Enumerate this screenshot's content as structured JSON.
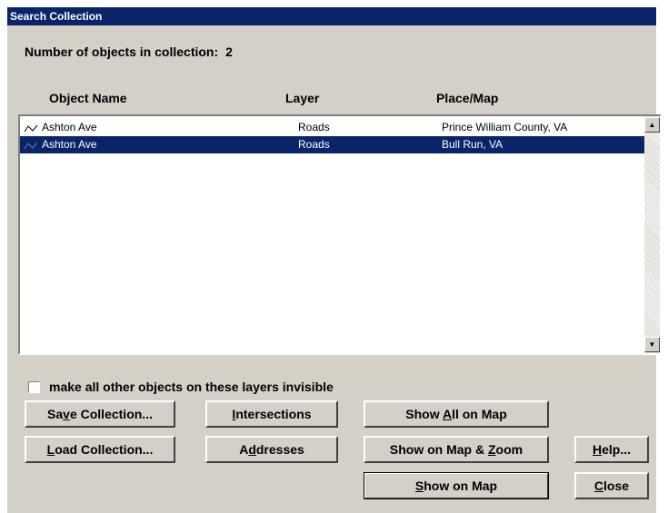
{
  "window": {
    "title": "Search Collection"
  },
  "count": {
    "label": "Number of objects in collection:",
    "value": "2"
  },
  "columns": [
    "Object Name",
    "Layer",
    "Place/Map"
  ],
  "rows": [
    {
      "icon": "line-feature-icon",
      "name": "Ashton Ave",
      "layer": "Roads",
      "place": "Prince William County, VA",
      "selected": false
    },
    {
      "icon": "line-feature-icon",
      "name": "Ashton Ave",
      "layer": "Roads",
      "place": "Bull Run, VA",
      "selected": true
    }
  ],
  "checkbox": {
    "label": "make all other objects on these layers invisible",
    "checked": false
  },
  "buttons": {
    "save_collection": {
      "before": "Sa",
      "key": "v",
      "after": "e Collection..."
    },
    "load_collection": {
      "before": "",
      "key": "L",
      "after": "oad Collection..."
    },
    "intersections": {
      "before": "",
      "key": "I",
      "after": "ntersections"
    },
    "addresses": {
      "before": "A",
      "key": "d",
      "after": "dresses"
    },
    "show_all_on_map": {
      "before": "Show ",
      "key": "A",
      "after": "ll on Map"
    },
    "show_on_map_zoom": {
      "before": "Show on Map & ",
      "key": "Z",
      "after": "oom"
    },
    "show_on_map": {
      "before": "",
      "key": "S",
      "after": "how on Map"
    },
    "help": {
      "before": "",
      "key": "H",
      "after": "elp..."
    },
    "close": {
      "before": "",
      "key": "C",
      "after": "lose"
    }
  },
  "scrollbar": {
    "up": "▲",
    "down": "▼"
  }
}
